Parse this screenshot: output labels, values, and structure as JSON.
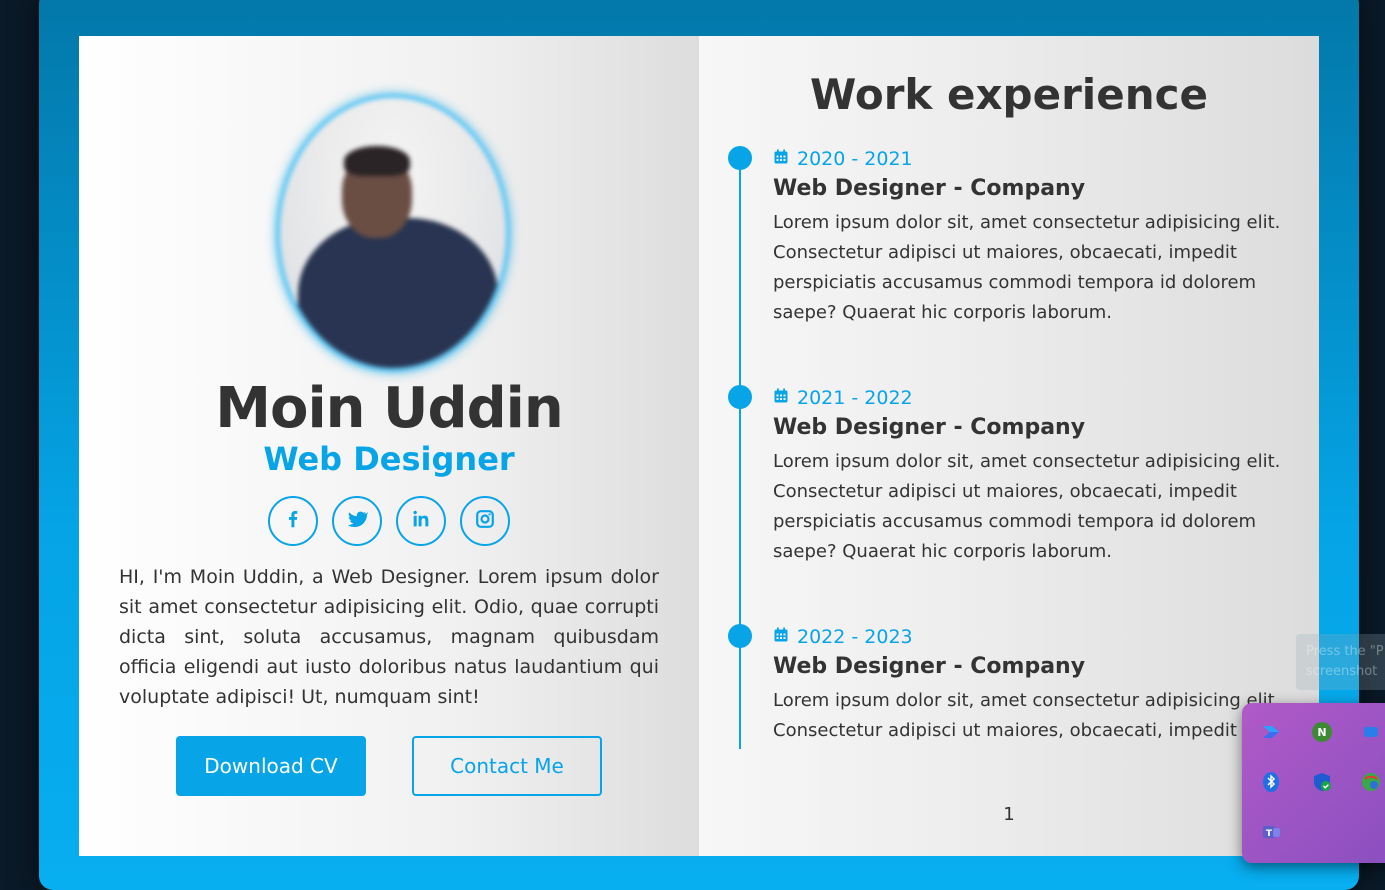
{
  "profile": {
    "name": "Moin Uddin",
    "role": "Web Designer",
    "bio": "HI, I'm Moin Uddin, a Web Designer. Lorem ipsum dolor sit amet consectetur adipisicing elit. Odio, quae corrupti dicta sint, soluta accusamus, magnam quibusdam officia eligendi aut iusto doloribus natus laudantium qui voluptate adipisci! Ut, numquam sint!",
    "socials": [
      {
        "icon": "facebook-icon"
      },
      {
        "icon": "twitter-icon"
      },
      {
        "icon": "linkedin-icon"
      },
      {
        "icon": "instagram-icon"
      }
    ],
    "download_label": "Download CV",
    "contact_label": "Contact Me"
  },
  "experience": {
    "heading": "Work experience",
    "items": [
      {
        "date": "2020 - 2021",
        "title": "Web Designer - Company",
        "text": "Lorem ipsum dolor sit, amet consectetur adipisicing elit. Consectetur adipisci ut maiores, obcaecati, impedit perspiciatis accusamus commodi tempora id dolorem saepe? Quaerat hic corporis laborum."
      },
      {
        "date": "2021 - 2022",
        "title": "Web Designer - Company",
        "text": "Lorem ipsum dolor sit, amet consectetur adipisicing elit. Consectetur adipisci ut maiores, obcaecati, impedit perspiciatis accusamus commodi tempora id dolorem saepe? Quaerat hic corporis laborum."
      },
      {
        "date": "2022 - 2023",
        "title": "Web Designer - Company",
        "text": "Lorem ipsum dolor sit, amet consectetur adipisicing elit. Consectetur adipisci ut maiores, obcaecati, impedit perspiciatis accusamus commodi tempora id dolorem saepe? Quaerat hic corporis laborum."
      }
    ],
    "page_number": "1"
  },
  "system": {
    "toast_text": "Press the \"P",
    "toast_text2": "screenshot",
    "tray_icons": [
      "power-automate-icon",
      "nvidia-icon",
      "shield-icon",
      "bluetooth-icon",
      "windows-security-icon",
      "network-icon",
      "teams-icon"
    ]
  },
  "colors": {
    "accent": "#08a4e8",
    "text": "#333333",
    "frame": "#05a4e6"
  }
}
